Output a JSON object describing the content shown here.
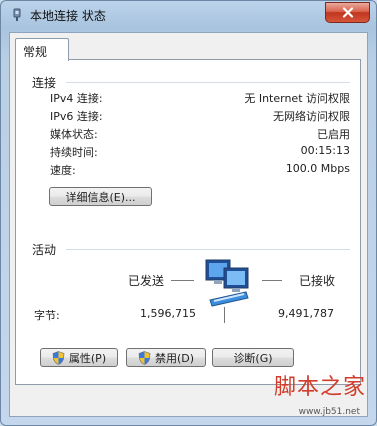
{
  "window": {
    "title": "本地连接 状态"
  },
  "tabs": [
    {
      "label": "常规"
    }
  ],
  "connection": {
    "heading": "连接",
    "rows": [
      {
        "label": "IPv4 连接:",
        "value": "无 Internet 访问权限"
      },
      {
        "label": "IPv6 连接:",
        "value": "无网络访问权限"
      },
      {
        "label": "媒体状态:",
        "value": "已启用"
      },
      {
        "label": "持续时间:",
        "value": "00:15:13"
      },
      {
        "label": "速度:",
        "value": "100.0 Mbps"
      }
    ],
    "details_button": "详细信息(E)..."
  },
  "activity": {
    "heading": "活动",
    "sent_label": "已发送",
    "received_label": "已接收",
    "bytes_label": "字节:",
    "sent_value": "1,596,715",
    "received_value": "9,491,787"
  },
  "buttons": {
    "properties": "属性(P)",
    "disable": "禁用(D)",
    "diagnose": "诊断(G)"
  },
  "watermark": {
    "brand": "脚本之家",
    "url": "www.jb51.net"
  },
  "colors": {
    "close": "#c0361e",
    "accent": "#2f6ec2"
  }
}
